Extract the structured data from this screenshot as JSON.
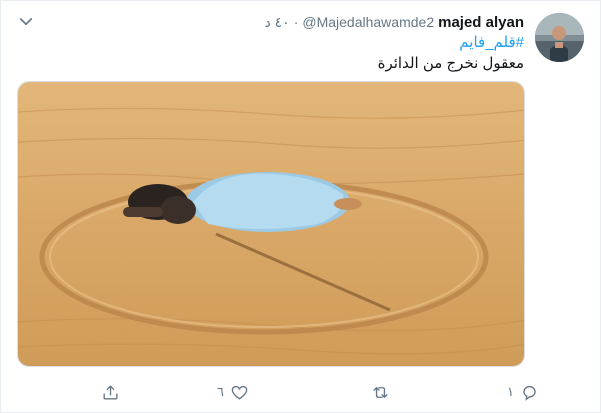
{
  "tweet": {
    "display_name": "majed alyan",
    "handle": "@Majedalhawamde2",
    "separator": "·",
    "timestamp": "٤٠ د",
    "hashtag": "#قلم_فايم",
    "text": "معقول نخرج من الدائرة",
    "media_icon": "photo",
    "avatar_icon": "user-photo"
  },
  "actions": {
    "reply_count": "١",
    "retweet_count": "",
    "like_count": "٦",
    "share_label": ""
  },
  "colors": {
    "link": "#1da1f2",
    "secondary_text": "#657786",
    "primary_text": "#14171a",
    "sand": "#d8a869"
  }
}
